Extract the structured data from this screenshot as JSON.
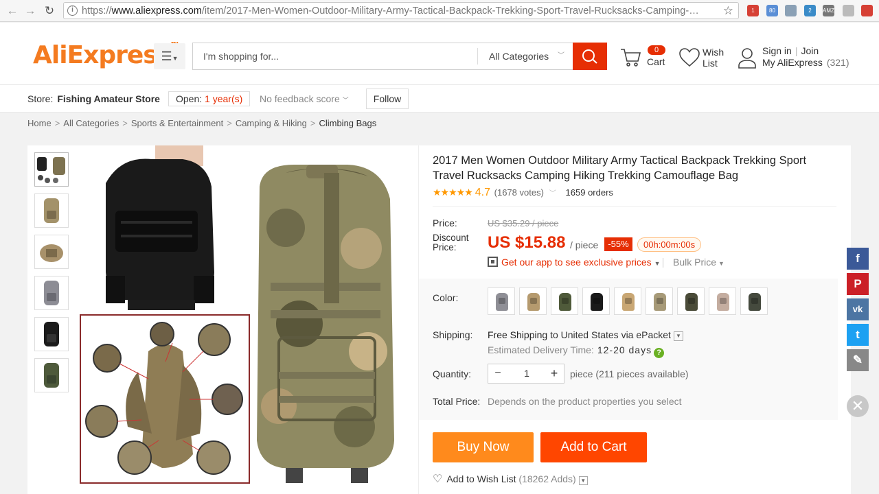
{
  "browser": {
    "url_prefix": "https://",
    "url_domain": "www.aliexpress.com",
    "url_path": "/item/2017-Men-Women-Outdoor-Military-Army-Tactical-Backpack-Trekking-Sport-Travel-Rucksacks-Camping-…",
    "extensions": [
      {
        "label": "1",
        "color": "#d64035"
      },
      {
        "label": "80",
        "color": "#5b8fd6"
      },
      {
        "label": "",
        "color": "#8aa0b5"
      },
      {
        "label": "2",
        "color": "#3a8bc8"
      },
      {
        "label": "AMZ",
        "color": "#777777"
      },
      {
        "label": "",
        "color": "#bbbbbb"
      },
      {
        "label": "",
        "color": "#d64035"
      }
    ]
  },
  "header": {
    "logo": "AliExpress",
    "search_placeholder": "I'm shopping for...",
    "category_select": "All Categories",
    "cart_count": "0",
    "cart_label": "Cart",
    "wish_label_1": "Wish",
    "wish_label_2": "List",
    "sign_in": "Sign in",
    "join": "Join",
    "my_aliexpress": "My AliExpress",
    "my_count": "(321)"
  },
  "store": {
    "label": "Store:",
    "name": "Fishing Amateur Store",
    "open_label": "Open:",
    "open_value": "1 year(s)",
    "feedback": "No feedback score",
    "follow": "Follow"
  },
  "breadcrumb": {
    "items": [
      "Home",
      "All Categories",
      "Sports & Entertainment",
      "Camping & Hiking"
    ],
    "current": "Climbing Bags"
  },
  "product": {
    "title": "2017 Men Women Outdoor Military Army Tactical Backpack Trekking Sport Travel Rucksacks Camping Hiking Trekking Camouflage Bag",
    "stars": "★★★★★",
    "rating": "4.7",
    "votes": "(1678 votes)",
    "orders": "1659 orders",
    "price_label": "Price:",
    "price_old": "US $35.29 / piece",
    "discount_label_1": "Discount",
    "discount_label_2": "Price:",
    "price_new": "US $15.88",
    "per_piece": "/ piece",
    "discount_pct": "-55%",
    "timer": "00h:00m:00s",
    "app_link": "Get our app to see exclusive prices",
    "bulk_price": "Bulk Price",
    "color_label": "Color:",
    "colors": [
      "#8f8f96",
      "#b59a6e",
      "#4f5a3a",
      "#1a1a1a",
      "#c9a774",
      "#a79a78",
      "#4a4b38",
      "#c4ada0",
      "#454a3e"
    ],
    "shipping_label": "Shipping:",
    "free_shipping": "Free Shipping",
    "shipping_rest": "to United States via ePacket",
    "est_label": "Estimated Delivery Time:",
    "est_days": "12-20 days",
    "qty_label": "Quantity:",
    "qty_value": "1",
    "qty_minus": "−",
    "qty_plus": "+",
    "available": "piece (211 pieces available)",
    "total_label": "Total Price:",
    "total_text": "Depends on the product properties you select",
    "buy_now": "Buy Now",
    "add_to_cart": "Add to Cart",
    "wish_add": "Add to Wish List",
    "wish_adds": "(18262 Adds)"
  },
  "share": [
    {
      "name": "facebook",
      "glyph": "f",
      "color": "#3b5998"
    },
    {
      "name": "pinterest",
      "glyph": "P",
      "color": "#cb2027"
    },
    {
      "name": "vk",
      "glyph": "vk",
      "color": "#4c75a3"
    },
    {
      "name": "twitter",
      "glyph": "t",
      "color": "#1da1f2"
    },
    {
      "name": "edit",
      "glyph": "✎",
      "color": "#888888"
    }
  ]
}
